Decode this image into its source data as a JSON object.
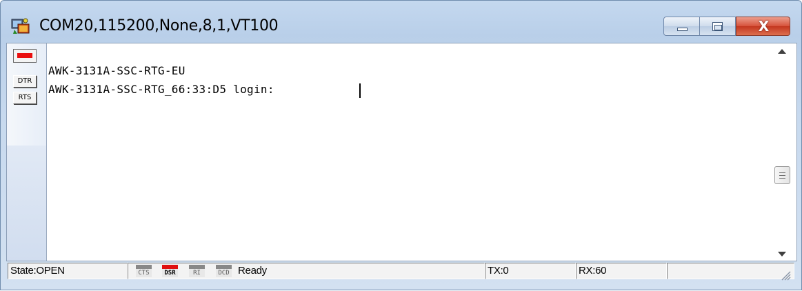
{
  "window": {
    "title": "COM20,115200,None,8,1,VT100",
    "icon": "terminal-app-icon",
    "controls": {
      "minimize": "minimize-icon",
      "maximize": "maximize-icon",
      "close_glyph": "X"
    }
  },
  "sidebar": {
    "led": {
      "icon": "led-indicator",
      "color": "#ea1010"
    },
    "dtr_label": "DTR",
    "rts_label": "RTS"
  },
  "terminal": {
    "lines": [
      "AWK-3131A-SSC-RTG-EU",
      "AWK-3131A-SSC-RTG_66:33:D5 login: "
    ]
  },
  "statusbar": {
    "state": "State:OPEN",
    "indicators": [
      {
        "label": "CTS",
        "active": false
      },
      {
        "label": "DSR",
        "active": true
      },
      {
        "label": "RI",
        "active": false
      },
      {
        "label": "DCD",
        "active": false
      }
    ],
    "status_text": "Ready",
    "tx": "TX:0",
    "rx": "RX:60"
  },
  "colors": {
    "active_led": "#e01010",
    "close_button": "#c3361f"
  }
}
